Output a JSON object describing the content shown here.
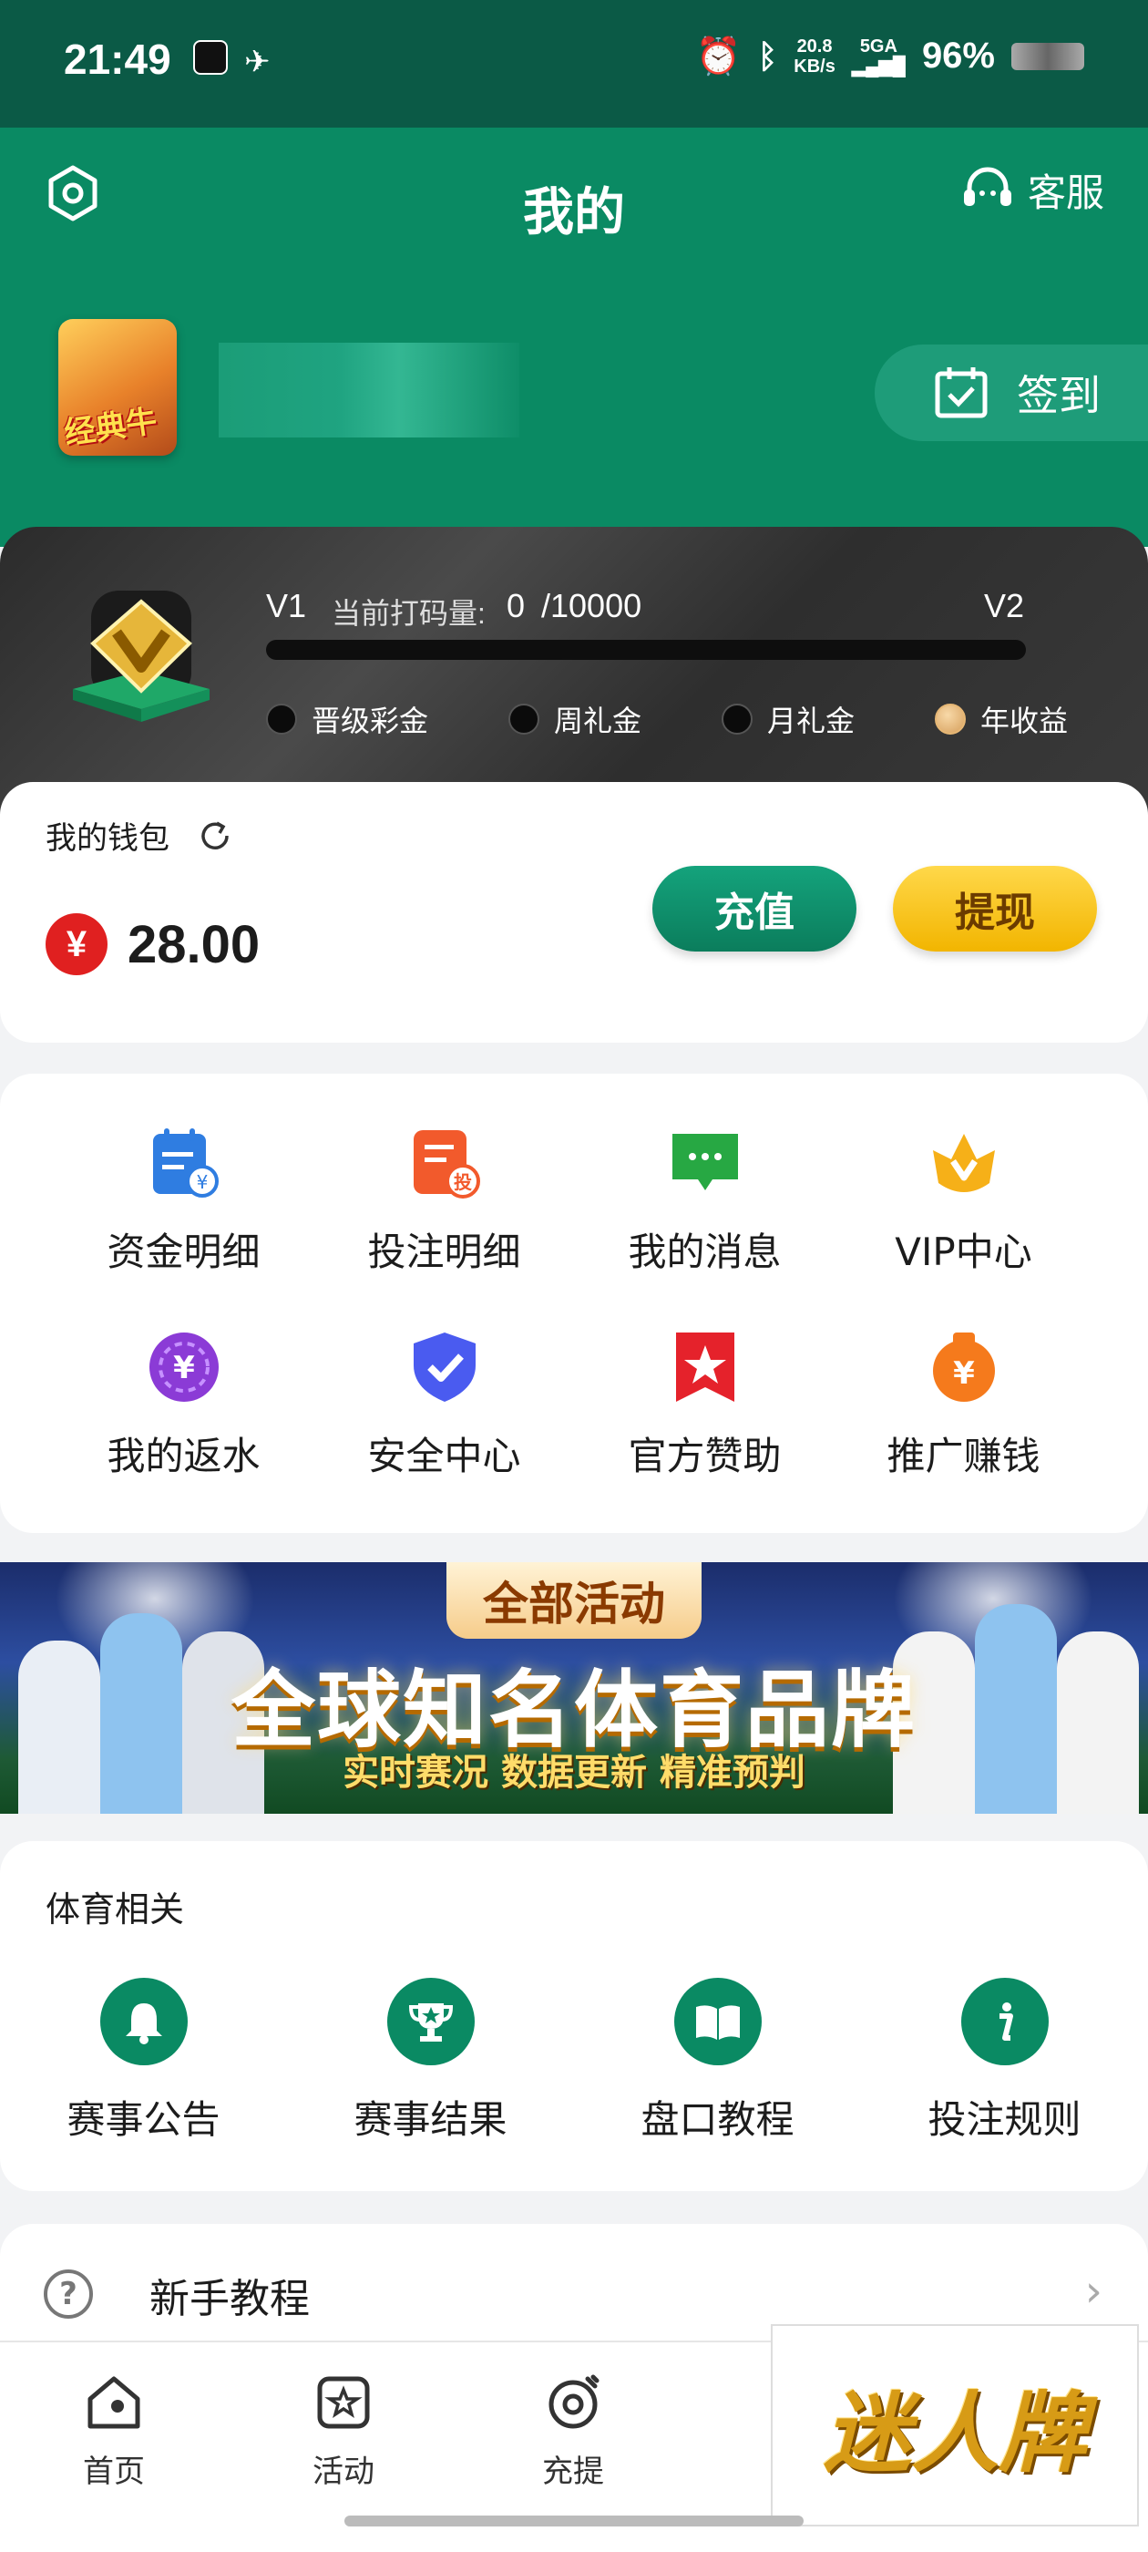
{
  "status_bar": {
    "time": "21:49",
    "net_speed_top": "20.8",
    "net_speed_bottom": "KB/s",
    "network": "5GA",
    "battery": "96%"
  },
  "header": {
    "title": "我的",
    "customer_service": "客服",
    "sign_in": "签到",
    "avatar_text": "经典牛"
  },
  "vip": {
    "current_level": "V1",
    "progress_label": "当前打码量:",
    "progress_value": "0",
    "progress_target": "/10000",
    "next_level": "V2",
    "progress_fraction": 0,
    "perks": [
      "晋级彩金",
      "周礼金",
      "月礼金",
      "年收益"
    ]
  },
  "wallet": {
    "label": "我的钱包",
    "currency_symbol": "¥",
    "balance": "28.00",
    "recharge": "充值",
    "withdraw": "提现"
  },
  "menu": [
    {
      "label": "资金明细",
      "icon": "fund-detail-icon",
      "color": "#2f7de1"
    },
    {
      "label": "投注明细",
      "icon": "bet-detail-icon",
      "color": "#f25a2c"
    },
    {
      "label": "我的消息",
      "icon": "message-icon",
      "color": "#27a843"
    },
    {
      "label": "VIP中心",
      "icon": "vip-crown-icon",
      "color": "#f6b018"
    },
    {
      "label": "我的返水",
      "icon": "rebate-icon",
      "color": "#8b3bd6"
    },
    {
      "label": "安全中心",
      "icon": "shield-check-icon",
      "color": "#4a5bf0"
    },
    {
      "label": "官方赞助",
      "icon": "sponsor-star-icon",
      "color": "#e5222b"
    },
    {
      "label": "推广赚钱",
      "icon": "promote-money-icon",
      "color": "#f57a1c"
    }
  ],
  "banner": {
    "tag": "全部活动",
    "headline": "全球知名体育品牌",
    "subline": "实时赛况 数据更新 精准预判"
  },
  "sports": {
    "title": "体育相关",
    "items": [
      {
        "label": "赛事公告",
        "icon": "bell-icon"
      },
      {
        "label": "赛事结果",
        "icon": "trophy-icon"
      },
      {
        "label": "盘口教程",
        "icon": "book-icon"
      },
      {
        "label": "投注规则",
        "icon": "info-icon"
      }
    ]
  },
  "tutorial": {
    "label": "新手教程"
  },
  "tabbar": {
    "items": [
      {
        "label": "首页",
        "icon": "home-icon"
      },
      {
        "label": "活动",
        "icon": "activity-star-icon"
      },
      {
        "label": "充提",
        "icon": "deposit-withdraw-icon"
      }
    ]
  },
  "promo": {
    "text": "迷人牌"
  },
  "colors": {
    "brand_green": "#0a8a63",
    "dark_green": "#0b5a46",
    "gold": "#f2b500"
  }
}
